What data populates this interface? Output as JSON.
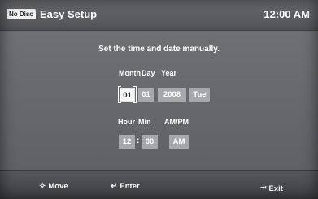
{
  "header": {
    "disc_status": "No Disc",
    "title": "Easy Setup",
    "clock": "12:00 AM"
  },
  "main": {
    "instruction": "Set the time and date manually.",
    "date_labels": {
      "month": "Month",
      "day": "Day",
      "year": "Year"
    },
    "date_values": {
      "month": "01",
      "day": "01",
      "year": "2008",
      "weekday": "Tue"
    },
    "time_labels": {
      "hour": "Hour",
      "min": "Min",
      "ampm": "AM/PM"
    },
    "time_values": {
      "hour": "12",
      "separator": ":",
      "min": "00",
      "ampm": "AM"
    }
  },
  "footer": {
    "move": {
      "icon": "directional-arrows-icon",
      "label": "Move"
    },
    "enter": {
      "icon": "enter-icon",
      "label": "Enter"
    },
    "exit": {
      "icon": "exit-icon",
      "label": "Exit"
    }
  },
  "colors": {
    "field_bg": "#a6a8ab",
    "selected_field_bg": "#f6f6f6",
    "text": "#ffffff"
  }
}
